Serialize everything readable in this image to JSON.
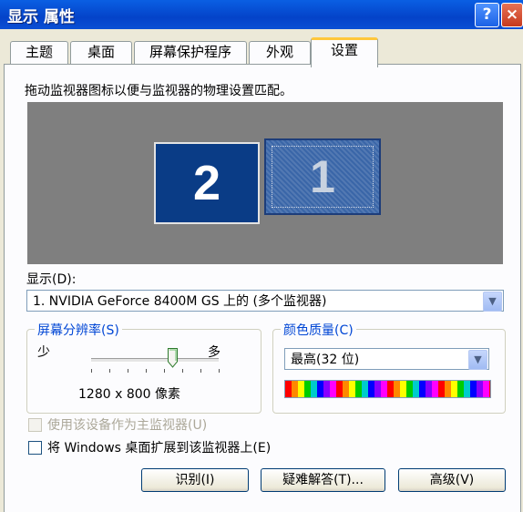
{
  "window": {
    "title": "显示 属性",
    "help_label": "?",
    "close_label": "×"
  },
  "tabs": [
    "主题",
    "桌面",
    "屏幕保护程序",
    "外观",
    "设置"
  ],
  "settings": {
    "instruction": "拖动监视器图标以便与监视器的物理设置匹配。",
    "monitors": [
      {
        "number": "2",
        "selected": true
      },
      {
        "number": "1",
        "selected": false
      }
    ],
    "display_label": "显示(D):",
    "display_value": "1. NVIDIA GeForce 8400M GS 上的 (多个监视器)",
    "resolution": {
      "group_label": "屏幕分辨率(S)",
      "less_label": "少",
      "more_label": "多",
      "value_text": "1280 x 800 像素",
      "slider_fraction": 0.64
    },
    "color_quality": {
      "group_label": "颜色质量(C)",
      "selected": "最高(32 位)"
    },
    "checkboxes": [
      {
        "label": "使用该设备作为主监视器(U)",
        "checked": false,
        "disabled": true
      },
      {
        "label": "将 Windows 桌面扩展到该监视器上(E)",
        "checked": false,
        "disabled": false
      }
    ],
    "buttons": {
      "identify": "识别(I)",
      "troubleshoot": "疑难解答(T)...",
      "advanced": "高级(V)"
    }
  },
  "colors": {
    "titlebar": "#0443c9",
    "active_tab_accent": "#ffc73c",
    "dialog_bg": "#ece9d8"
  }
}
